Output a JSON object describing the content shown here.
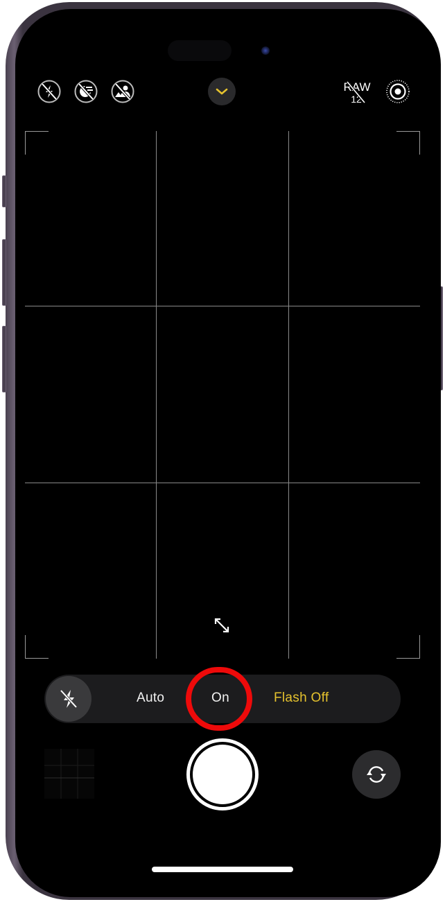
{
  "top_controls": {
    "flash_status": "flash-off-icon",
    "night_mode": "night-mode-off-icon",
    "portrait_mode": "portrait-off-icon",
    "expand_controls": "chevron-down-icon",
    "raw_label": "RAW",
    "raw_resolution": "12",
    "live_photo": "live-photo-icon"
  },
  "flash_menu": {
    "current_icon": "flash-off-icon",
    "options": [
      {
        "label": "Auto",
        "selected": false
      },
      {
        "label": "On",
        "selected": false,
        "highlighted": true
      },
      {
        "label": "Flash Off",
        "selected": true
      }
    ]
  },
  "colors": {
    "accent_yellow": "#e5c22e",
    "highlight_red": "#ee0a0a",
    "frame": "#3b3440"
  },
  "bottom_controls": {
    "thumbnail": "last-photo-thumbnail",
    "shutter": "shutter-button",
    "flip": "camera-flip-icon"
  }
}
